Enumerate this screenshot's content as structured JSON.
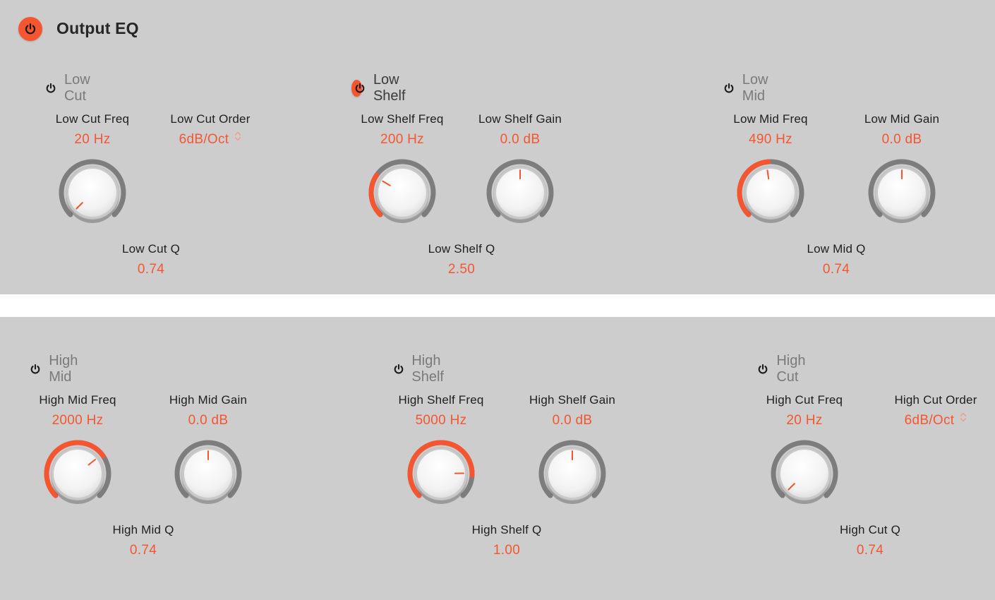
{
  "plugin": {
    "title": "Output EQ",
    "power": "on",
    "power_icon": "power-icon"
  },
  "colors": {
    "accent": "#f5562f",
    "panel_bg": "#cdcdcd",
    "ring_track": "#7d7d7d",
    "label_text": "#1e1e1e",
    "band_title_off": "#7a7a7a",
    "band_title_on": "#3a3a3a"
  },
  "bands": [
    {
      "id": "low-cut",
      "title": "Low Cut",
      "enabled": false,
      "freq": {
        "label": "Low Cut Freq",
        "value": "20 Hz",
        "position": 0.0
      },
      "second": {
        "type": "order",
        "label": "Low Cut Order",
        "value": "6dB/Oct"
      },
      "q": {
        "label": "Low Cut Q",
        "value": "0.74"
      }
    },
    {
      "id": "low-shelf",
      "title": "Low Shelf",
      "enabled": true,
      "freq": {
        "label": "Low Shelf Freq",
        "value": "200 Hz",
        "position": 0.28
      },
      "second": {
        "type": "gain",
        "label": "Low Shelf Gain",
        "value": "0.0 dB",
        "position": 0.5
      },
      "q": {
        "label": "Low Shelf Q",
        "value": "2.50"
      }
    },
    {
      "id": "low-mid",
      "title": "Low Mid",
      "enabled": false,
      "freq": {
        "label": "Low Mid Freq",
        "value": "490 Hz",
        "position": 0.47
      },
      "second": {
        "type": "gain",
        "label": "Low Mid Gain",
        "value": "0.0 dB",
        "position": 0.5
      },
      "q": {
        "label": "Low Mid Q",
        "value": "0.74"
      }
    },
    {
      "id": "high-mid",
      "title": "High Mid",
      "enabled": false,
      "freq": {
        "label": "High Mid Freq",
        "value": "2000 Hz",
        "position": 0.69
      },
      "second": {
        "type": "gain",
        "label": "High Mid Gain",
        "value": "0.0 dB",
        "position": 0.5
      },
      "q": {
        "label": "High Mid Q",
        "value": "0.74"
      }
    },
    {
      "id": "high-shelf",
      "title": "High Shelf",
      "enabled": false,
      "freq": {
        "label": "High Shelf Freq",
        "value": "5000 Hz",
        "position": 0.83
      },
      "second": {
        "type": "gain",
        "label": "High Shelf Gain",
        "value": "0.0 dB",
        "position": 0.5
      },
      "q": {
        "label": "High Shelf Q",
        "value": "1.00"
      }
    },
    {
      "id": "high-cut",
      "title": "High Cut",
      "enabled": false,
      "freq": {
        "label": "High Cut Freq",
        "value": "20 Hz",
        "position": 0.0
      },
      "second": {
        "type": "order",
        "label": "High Cut Order",
        "value": "6dB/Oct"
      },
      "q": {
        "label": "High Cut Q",
        "value": "0.74"
      }
    }
  ]
}
